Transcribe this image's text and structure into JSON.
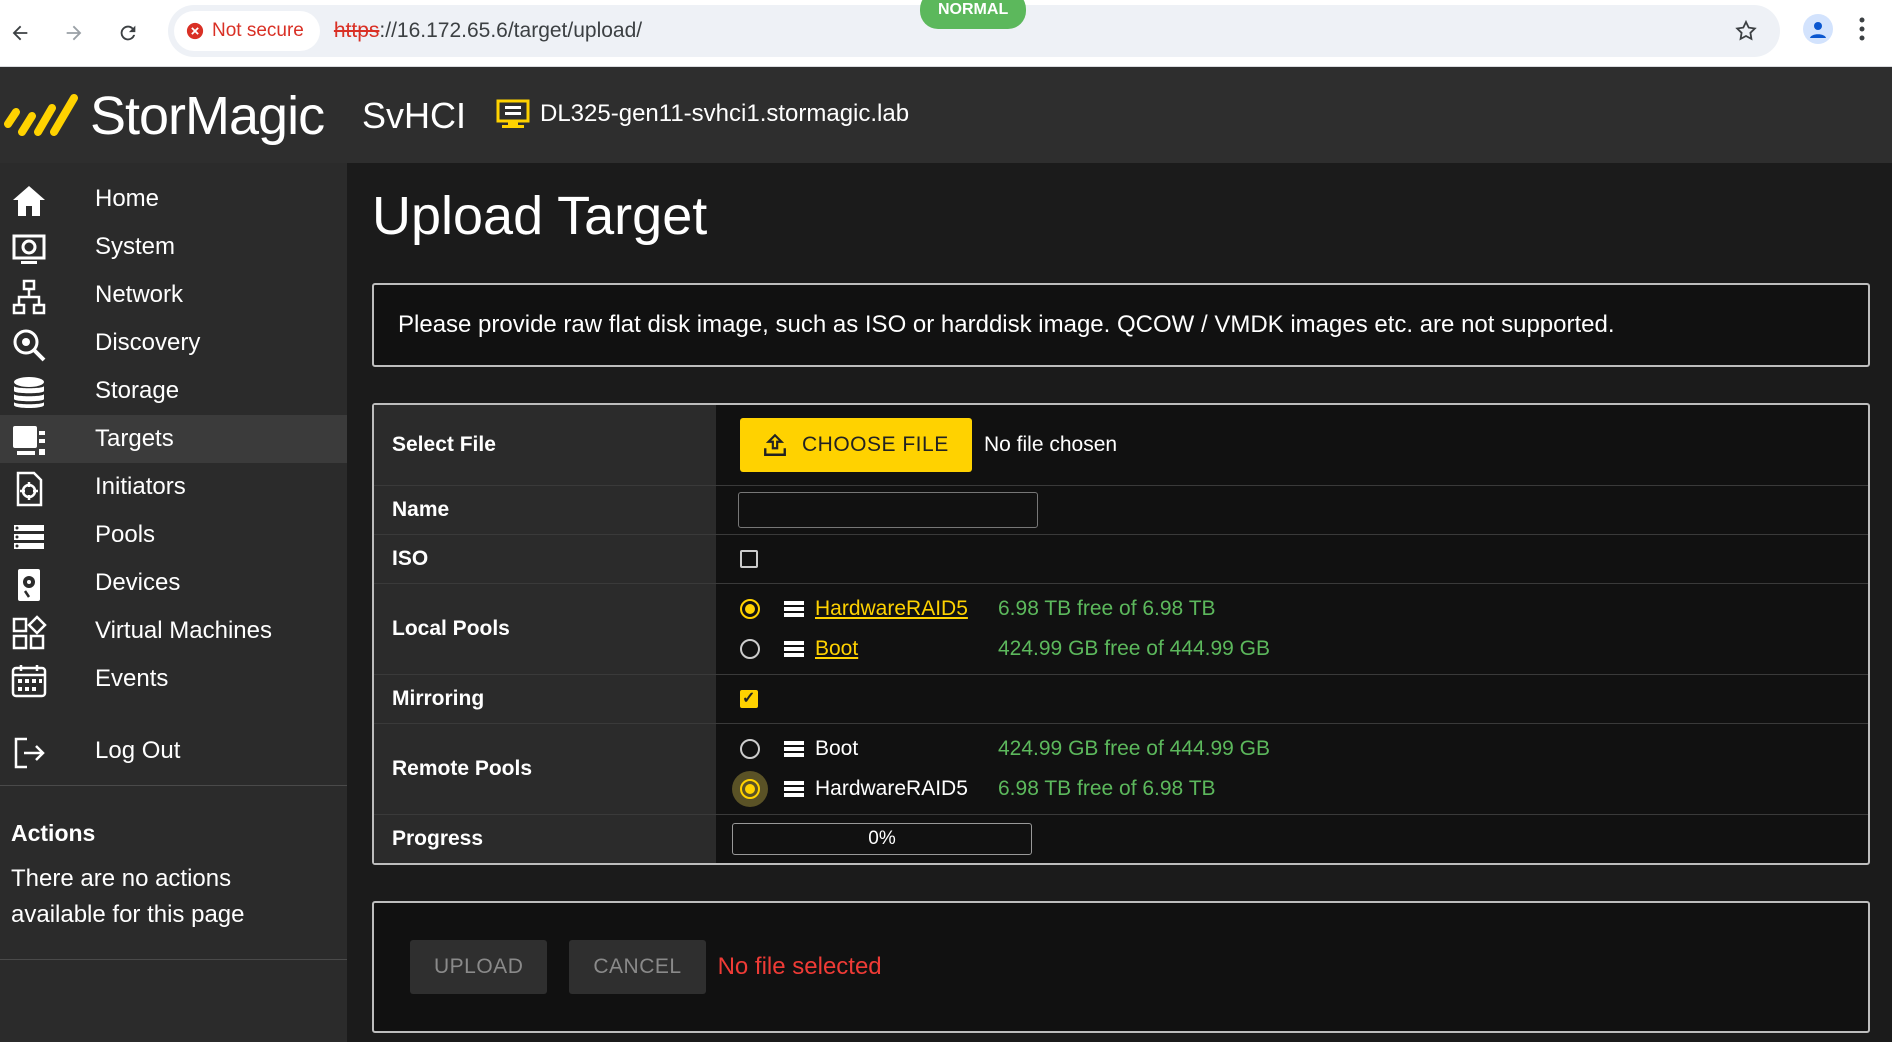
{
  "browser": {
    "security_label": "Not secure",
    "url_scheme": "https",
    "url_rest": "://16.172.65.6/target/upload/"
  },
  "header": {
    "brand": "StorMagic",
    "product": "SvHCI",
    "host": "DL325-gen11-svhci1.stormagic.lab",
    "status_badge": "NORMAL",
    "accent_color": "#ffd200",
    "status_color": "#5cb85c"
  },
  "sidebar": {
    "items": [
      {
        "label": "Home",
        "icon": "home-icon"
      },
      {
        "label": "System",
        "icon": "system-icon"
      },
      {
        "label": "Network",
        "icon": "network-icon"
      },
      {
        "label": "Discovery",
        "icon": "discovery-icon"
      },
      {
        "label": "Storage",
        "icon": "storage-icon"
      },
      {
        "label": "Targets",
        "icon": "targets-icon"
      },
      {
        "label": "Initiators",
        "icon": "initiators-icon"
      },
      {
        "label": "Pools",
        "icon": "pools-icon"
      },
      {
        "label": "Devices",
        "icon": "devices-icon"
      },
      {
        "label": "Virtual Machines",
        "icon": "virtual-machines-icon"
      },
      {
        "label": "Events",
        "icon": "events-icon"
      }
    ],
    "logout": "Log Out",
    "actions_title": "Actions",
    "actions_text": "There are no actions available for this page"
  },
  "main": {
    "title": "Upload Target",
    "info": "Please provide raw flat disk image, such as ISO or harddisk image. QCOW / VMDK images etc. are not supported.",
    "form": {
      "select_file_label": "Select File",
      "choose_file_button": "CHOOSE FILE",
      "no_file_chosen": "No file chosen",
      "name_label": "Name",
      "name_value": "",
      "iso_label": "ISO",
      "iso_checked": false,
      "local_pools_label": "Local Pools",
      "local_pools": [
        {
          "name": "HardwareRAID5",
          "free": "6.98 TB free of 6.98 TB",
          "selected": true
        },
        {
          "name": "Boot",
          "free": "424.99 GB free of 444.99 GB",
          "selected": false
        }
      ],
      "mirroring_label": "Mirroring",
      "mirroring_checked": true,
      "remote_pools_label": "Remote Pools",
      "remote_pools": [
        {
          "name": "Boot",
          "free": "424.99 GB free of 444.99 GB",
          "selected": false
        },
        {
          "name": "HardwareRAID5",
          "free": "6.98 TB free of 6.98 TB",
          "selected": true
        }
      ],
      "progress_label": "Progress",
      "progress_value": 0,
      "progress_text": "0%"
    },
    "actions": {
      "upload": "UPLOAD",
      "cancel": "CANCEL",
      "status": "No file selected"
    }
  }
}
